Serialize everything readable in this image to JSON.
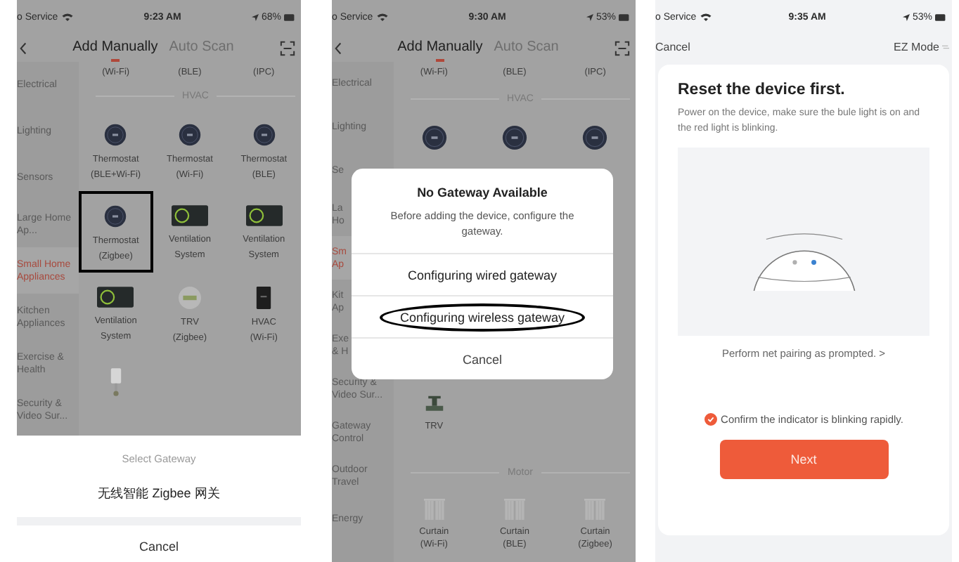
{
  "panels": [
    {
      "kind": "add-device",
      "status_bar": {
        "carrier": "o Service",
        "time": "9:23 AM",
        "battery": "68%"
      },
      "tabs": [
        {
          "label": "Add Manually",
          "selected": true
        },
        {
          "label": "Auto Scan",
          "selected": false
        }
      ],
      "categories": [
        {
          "label": "Electrical",
          "selected": false
        },
        {
          "label": "Lighting",
          "selected": false
        },
        {
          "label": "Sensors",
          "selected": false
        },
        {
          "label": "Large Home Ap...",
          "selected": false
        },
        {
          "label": "Small Home Appliances",
          "selected": true
        },
        {
          "label": "Kitchen Appliances",
          "selected": false
        },
        {
          "label": "Exercise & Health",
          "selected": false
        },
        {
          "label": "Security & Video Sur...",
          "selected": false
        }
      ],
      "sections": [
        {
          "kind": "cut-row",
          "labels": [
            "(Wi-Fi)",
            "(BLE)",
            "(IPC)"
          ]
        },
        {
          "kind": "heading",
          "title": "HVAC"
        },
        {
          "kind": "devices",
          "devices": [
            {
              "kind": "thermostat",
              "label": "Thermostat\n(BLE+Wi-Fi)",
              "highlighted": false
            },
            {
              "kind": "thermostat",
              "label": "Thermostat\n(Wi-Fi)",
              "highlighted": false
            },
            {
              "kind": "thermostat",
              "label": "Thermostat\n(BLE)",
              "highlighted": false
            }
          ]
        },
        {
          "kind": "devices",
          "devices": [
            {
              "kind": "thermostat",
              "label": "Thermostat\n(Zigbee)",
              "highlighted": true
            },
            {
              "kind": "ventilation",
              "label": "Ventilation\nSystem",
              "highlighted": false
            },
            {
              "kind": "ventilation",
              "label": "Ventilation\nSystem",
              "highlighted": false
            }
          ]
        },
        {
          "kind": "devices",
          "devices": [
            {
              "kind": "ventilation",
              "label": "Ventilation\nSystem",
              "highlighted": false
            },
            {
              "kind": "trv",
              "label": "TRV\n(Zigbee)",
              "highlighted": false
            },
            {
              "kind": "hvac",
              "label": "HVAC\n(Wi-Fi)",
              "highlighted": false
            }
          ]
        },
        {
          "kind": "devices",
          "devices": [
            {
              "kind": "plug",
              "highlighted": false
            }
          ]
        }
      ],
      "sheet": {
        "title": "Select Gateway",
        "options": [
          "无线智能 Zigbee 网关"
        ],
        "cancel": "Cancel"
      }
    },
    {
      "kind": "add-device",
      "status_bar": {
        "carrier": "o Service",
        "time": "9:30 AM",
        "battery": "53%"
      },
      "tabs": [
        {
          "label": "Add Manually",
          "selected": true
        },
        {
          "label": "Auto Scan",
          "selected": false
        }
      ],
      "categories": [
        {
          "label": "Electrical",
          "selected": false
        },
        {
          "label": "Lighting",
          "selected": false
        },
        {
          "label": "Se",
          "selected": false
        },
        {
          "label": "La\nHo",
          "selected": false
        },
        {
          "label": "Sm\nAp",
          "selected": true
        },
        {
          "label": "Kit\nAp",
          "selected": false
        },
        {
          "label": "Exe\n& H",
          "selected": false
        },
        {
          "label": "Security & Video Sur...",
          "selected": false
        },
        {
          "label": "Gateway Control",
          "selected": false
        },
        {
          "label": "Outdoor Travel",
          "selected": false
        },
        {
          "label": "Energy",
          "selected": false
        }
      ],
      "sections": [
        {
          "kind": "cut-row",
          "labels": [
            "(Wi-Fi)",
            "(BLE)",
            "(IPC)"
          ]
        },
        {
          "kind": "heading",
          "title": "HVAC"
        },
        {
          "kind": "devices",
          "devices": [
            {
              "kind": "thermostat",
              "highlighted": false
            },
            {
              "kind": "thermostat",
              "highlighted": false
            },
            {
              "kind": "thermostat",
              "highlighted": false
            }
          ]
        },
        {
          "kind": "covered"
        },
        {
          "kind": "devices",
          "devices": [
            {
              "kind": "valve",
              "label": "TRV",
              "highlighted": false
            }
          ]
        },
        {
          "kind": "heading",
          "title": "Motor"
        },
        {
          "kind": "devices",
          "devices": [
            {
              "kind": "curtain",
              "label": "Curtain\n(Wi-Fi)",
              "highlighted": false
            },
            {
              "kind": "curtain",
              "label": "Curtain\n(BLE)",
              "highlighted": false
            },
            {
              "kind": "curtain",
              "label": "Curtain\n(Zigbee)",
              "highlighted": false
            }
          ]
        }
      ],
      "dialog": {
        "title": "No Gateway Available",
        "message": "Before adding the device, configure the gateway.",
        "actions": [
          {
            "label": "Configuring wired gateway",
            "circled": false
          },
          {
            "label": "Configuring wireless gateway",
            "circled": true
          },
          {
            "label": "Cancel",
            "circled": false
          }
        ]
      }
    },
    {
      "kind": "reset",
      "status_bar": {
        "carrier": "o Service",
        "time": "9:35 AM",
        "battery": "53%"
      },
      "nav": {
        "cancel": "Cancel",
        "mode": "EZ Mode"
      },
      "card": {
        "title": "Reset the device first.",
        "message": "Power on the device, make sure the bule light is on and the red light is blinking.",
        "link": "Perform net pairing as prompted. >",
        "confirm": {
          "label": "Confirm the indicator is blinking rapidly.",
          "checked": true
        },
        "button": "Next"
      }
    }
  ]
}
